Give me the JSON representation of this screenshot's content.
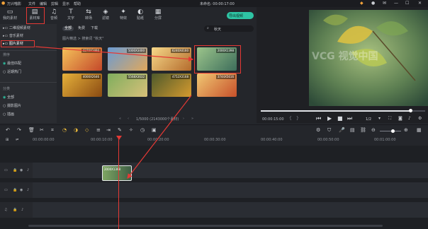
{
  "app": {
    "title": "万兴喵影",
    "menu": [
      "文件",
      "编辑",
      "剪辑",
      "显示",
      "帮助"
    ],
    "timecode_title": "未命名: 00:00:17:00",
    "export_label": "导出视频"
  },
  "toolbar": {
    "items": [
      {
        "icon": "folder-icon",
        "label": "我的素材"
      },
      {
        "icon": "library-icon",
        "label": "素材库"
      },
      {
        "icon": "music-icon",
        "label": "音频"
      },
      {
        "icon": "text-icon",
        "label": "文字"
      },
      {
        "icon": "transition-icon",
        "label": "转场"
      },
      {
        "icon": "filter-icon",
        "label": "滤镜"
      },
      {
        "icon": "effect-icon",
        "label": "特效"
      },
      {
        "icon": "sticker-icon",
        "label": "贴纸"
      },
      {
        "icon": "split-screen-icon",
        "label": "分屏"
      }
    ]
  },
  "sidebar": {
    "categories": [
      "二维视频素材",
      "音乐素材",
      "图片素材"
    ],
    "sort_title": "排序",
    "sort_options": [
      "最佳匹配",
      "近期热门"
    ],
    "filter_title": "分类",
    "filter_options": [
      "全部",
      "摄影图片",
      "插画"
    ]
  },
  "media": {
    "tabs": [
      "全部",
      "免费",
      "下载"
    ],
    "breadcrumb": "图片精选 > 搜索词 \"秋天\"",
    "search_placeholder": "秋天",
    "thumbs": [
      {
        "tag": "4370X2460",
        "color1": "#f4c35a",
        "color2": "#c4482a"
      },
      {
        "tag": "5000X3400",
        "color1": "#6a9bd4",
        "color2": "#e0a85c"
      },
      {
        "tag": "6240X4160",
        "color1": "#f6d889",
        "color2": "#b46b2c"
      },
      {
        "tag": "2000X1398",
        "color1": "#9cc58b",
        "color2": "#3d6d5b"
      },
      {
        "tag": "4000X2646",
        "color1": "#e6b13a",
        "color2": "#8a4a12"
      },
      {
        "tag": "5568X3632",
        "color1": "#7fae5d",
        "color2": "#d8c07a"
      },
      {
        "tag": "4752X3168",
        "color1": "#4e5a2c",
        "color2": "#d59a2e"
      },
      {
        "tag": "3744X5616",
        "color1": "#f0c873",
        "color2": "#c7502a"
      }
    ],
    "pagination": "1/5000 (2143000个素材)"
  },
  "preview": {
    "watermark": "VCG 视觉中国",
    "current_time": "00:00:15:00",
    "ratio": "1/2",
    "progress": 0.91
  },
  "timeline": {
    "ruler_marks": [
      "00:00:00:00",
      "00:00:10:00",
      "00:00:20:00",
      "00:00:30:00",
      "00:00:40:00",
      "00:00:50:00",
      "00:01:00:00"
    ],
    "clip_label": "2000X1398"
  }
}
